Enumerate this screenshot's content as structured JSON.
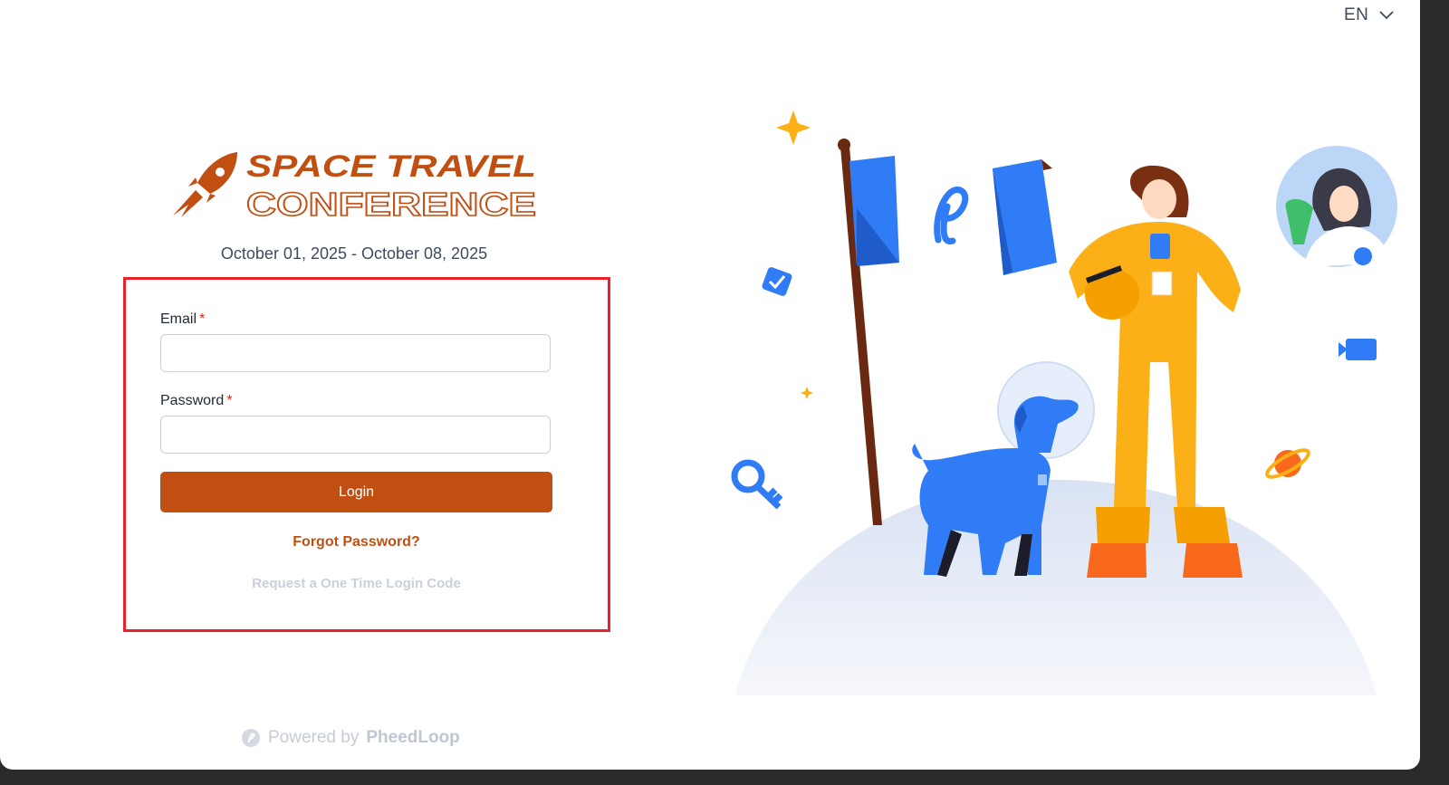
{
  "language": {
    "current": "EN",
    "icon": "chevron-down-icon"
  },
  "logo": {
    "line1": "SPACE TRAVEL",
    "line2": "CONFERENCE",
    "brand_color": "#c24f12",
    "icon": "rocket-icon"
  },
  "event": {
    "dates": "October 01, 2025 - October 08, 2025"
  },
  "form": {
    "email_label": "Email",
    "email_value": "",
    "password_label": "Password",
    "password_value": "",
    "required_marker": "*",
    "login_label": "Login",
    "forgot_label": "Forgot Password?",
    "otp_label": "Request a One Time Login Code",
    "highlight_color": "#e8232b"
  },
  "footer": {
    "prefix": "Powered by",
    "brand": "PheedLoop",
    "icon": "pheedloop-logo-icon"
  },
  "colors": {
    "accent": "#c24f12",
    "illustration_blue": "#2f7cf6",
    "illustration_yellow": "#fbb017"
  }
}
